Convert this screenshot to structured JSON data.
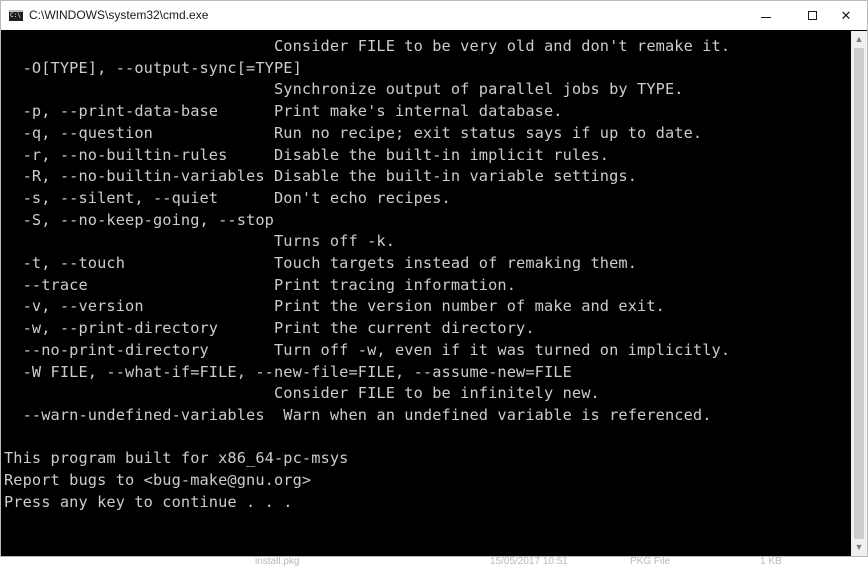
{
  "window": {
    "title": "C:\\WINDOWS\\system32\\cmd.exe",
    "close_glyph": "✕"
  },
  "console": {
    "lines": [
      "                             Consider FILE to be very old and don't remake it.",
      "  -O[TYPE], --output-sync[=TYPE]",
      "                             Synchronize output of parallel jobs by TYPE.",
      "  -p, --print-data-base      Print make's internal database.",
      "  -q, --question             Run no recipe; exit status says if up to date.",
      "  -r, --no-builtin-rules     Disable the built-in implicit rules.",
      "  -R, --no-builtin-variables Disable the built-in variable settings.",
      "  -s, --silent, --quiet      Don't echo recipes.",
      "  -S, --no-keep-going, --stop",
      "                             Turns off -k.",
      "  -t, --touch                Touch targets instead of remaking them.",
      "  --trace                    Print tracing information.",
      "  -v, --version              Print the version number of make and exit.",
      "  -w, --print-directory      Print the current directory.",
      "  --no-print-directory       Turn off -w, even if it was turned on implicitly.",
      "  -W FILE, --what-if=FILE, --new-file=FILE, --assume-new=FILE",
      "                             Consider FILE to be infinitely new.",
      "  --warn-undefined-variables  Warn when an undefined variable is referenced.",
      "",
      "This program built for x86_64-pc-msys",
      "Report bugs to <bug-make@gnu.org>",
      "Press any key to continue . . ."
    ]
  },
  "background": {
    "taskbar_items": [
      "install.pkg",
      "15/05/2017 10:51",
      "PKG File",
      "1 KB"
    ]
  }
}
